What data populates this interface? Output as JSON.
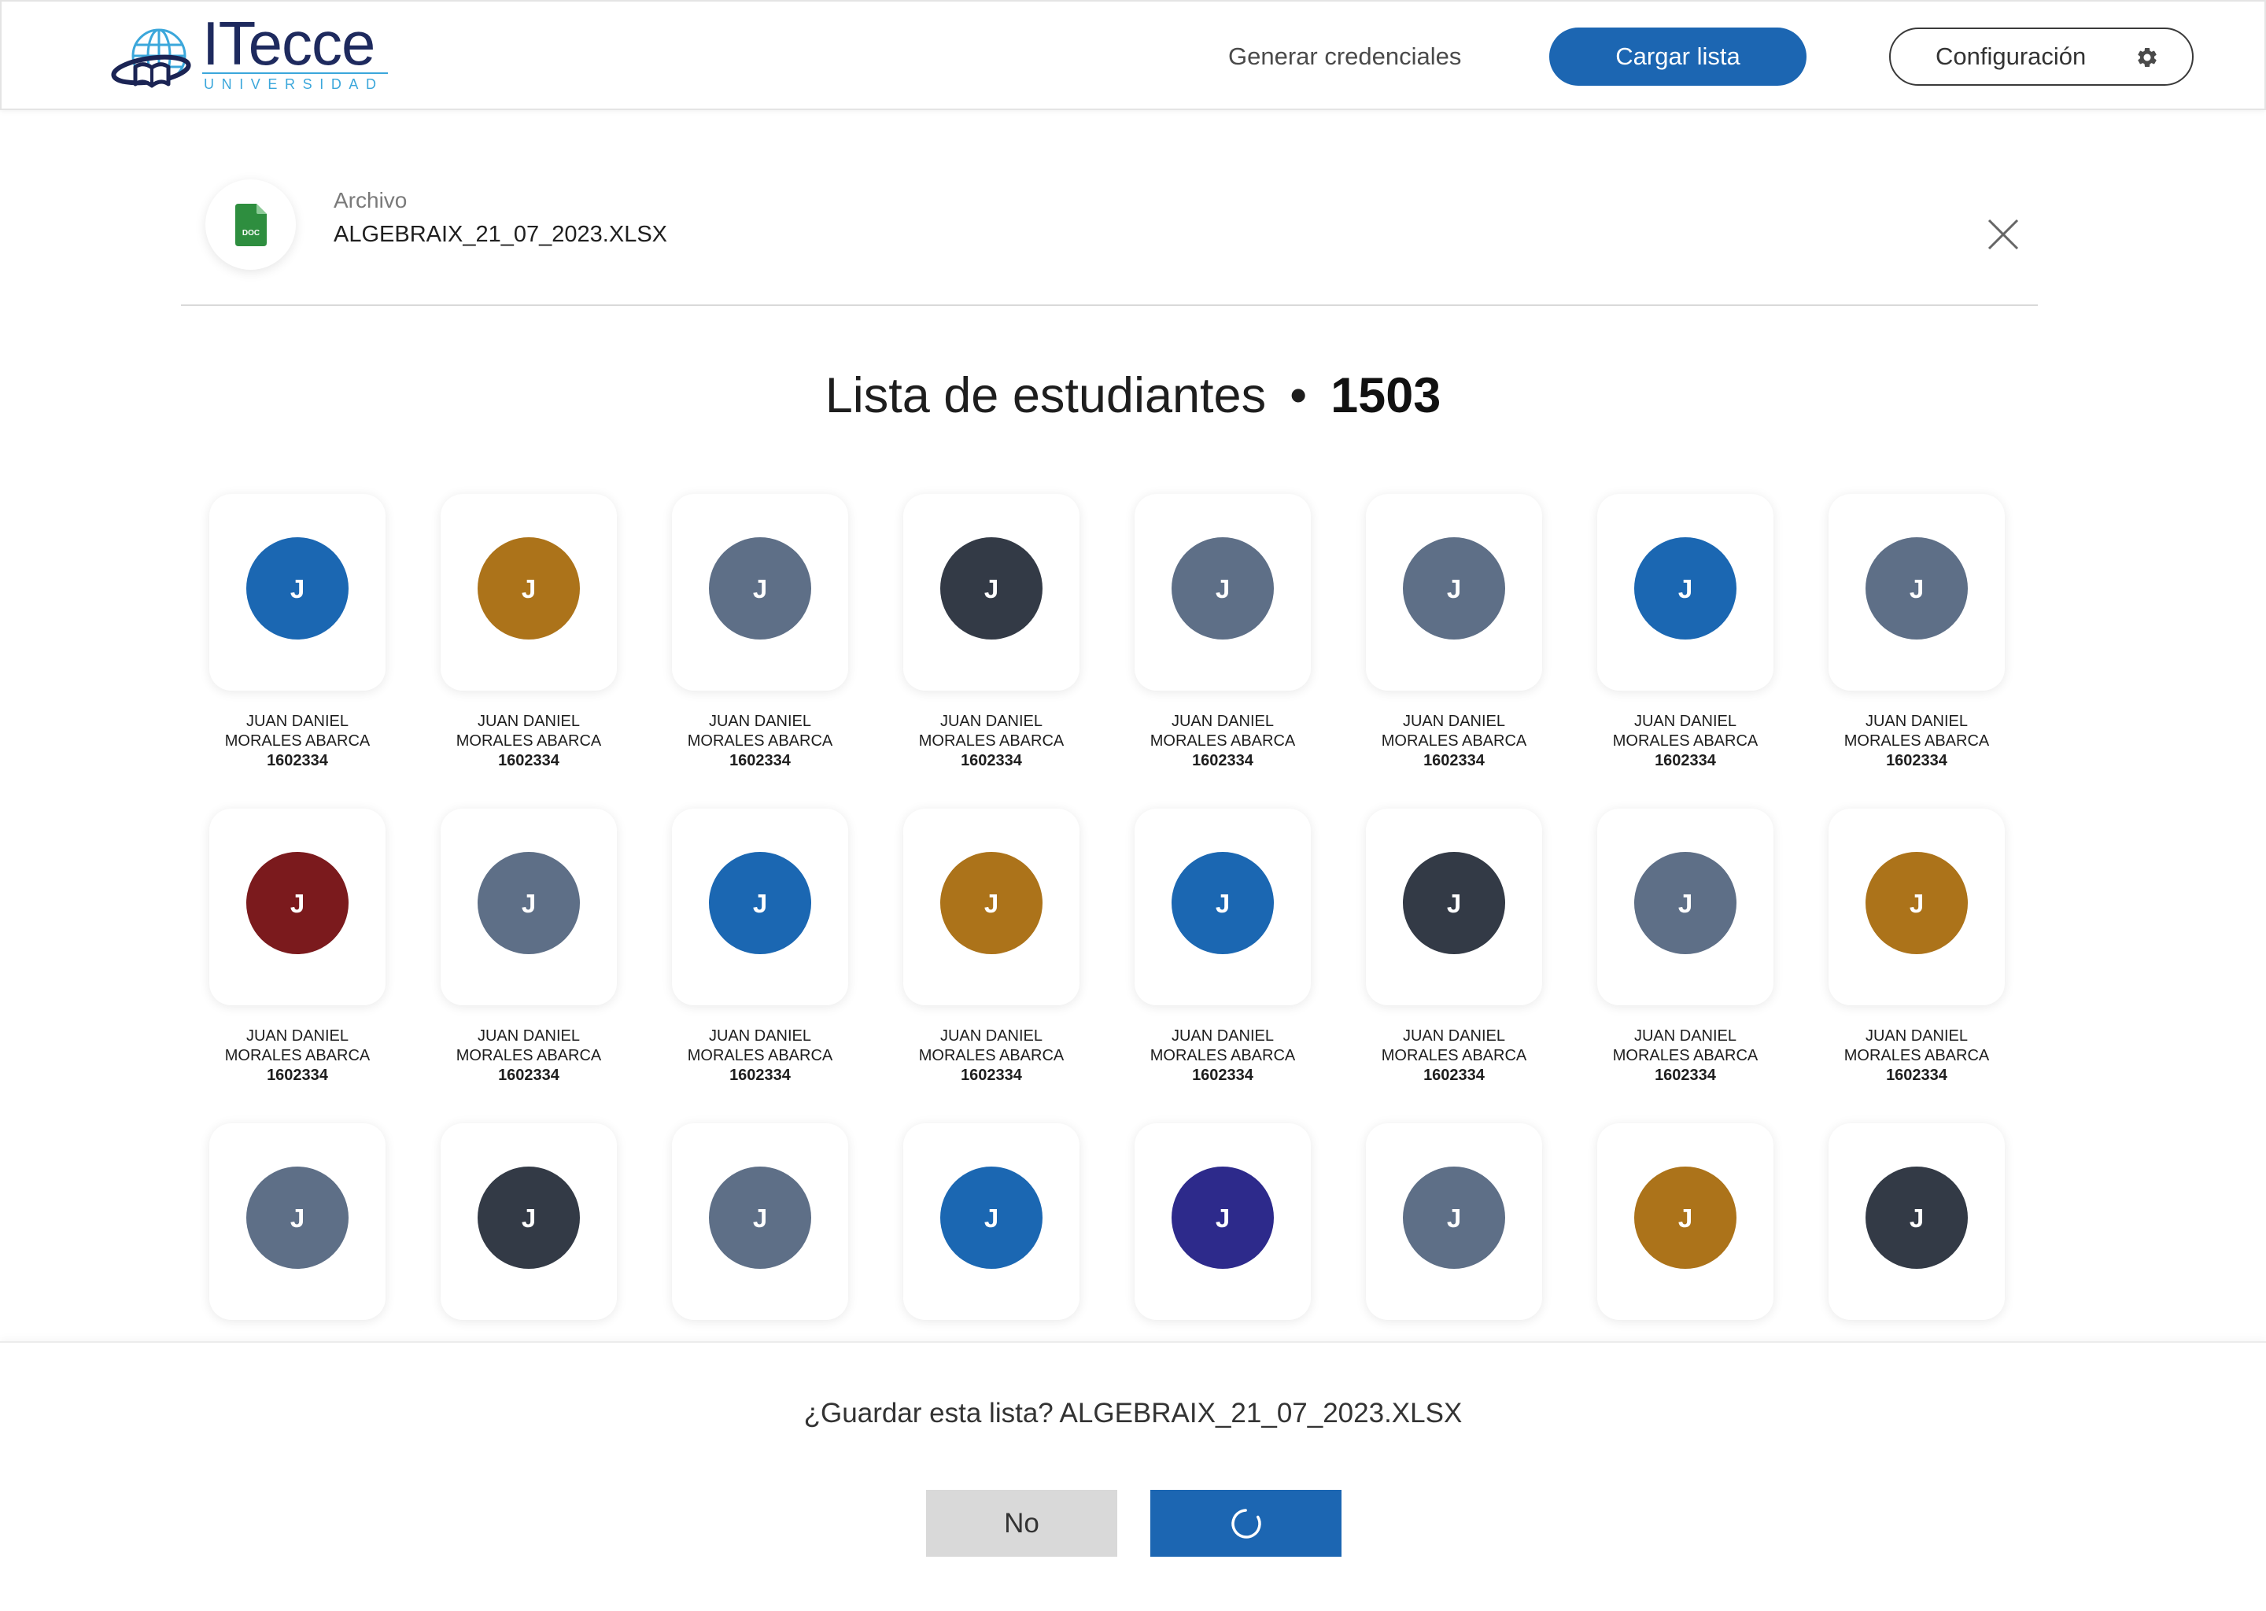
{
  "header": {
    "logo": {
      "wordmark": "ITecce",
      "tagline": "UNIVERSIDAD",
      "icon": "globe-book-logo-icon"
    },
    "nav": {
      "generate_credentials": "Generar credenciales",
      "upload_list": "Cargar lista",
      "settings": "Configuración",
      "settings_icon": "gear-icon"
    }
  },
  "file_panel": {
    "label": "Archivo",
    "filename": "ALGEBRAIX_21_07_2023.XLSX",
    "file_icon": "doc-file-icon",
    "file_type": "DOC",
    "close_icon": "close-icon"
  },
  "student_list": {
    "title": "Lista de estudiantes",
    "separator": "•",
    "count": "1503"
  },
  "students": [
    {
      "initial": "J",
      "color": "#1B67B2",
      "name": "JUAN DANIEL MORALES ABARCA",
      "id": "1602334"
    },
    {
      "initial": "J",
      "color": "#AC731A",
      "name": "JUAN DANIEL MORALES ABARCA",
      "id": "1602334"
    },
    {
      "initial": "J",
      "color": "#5E6F87",
      "name": "JUAN DANIEL MORALES ABARCA",
      "id": "1602334"
    },
    {
      "initial": "J",
      "color": "#333A46",
      "name": "JUAN DANIEL MORALES ABARCA",
      "id": "1602334"
    },
    {
      "initial": "J",
      "color": "#5E6F87",
      "name": "JUAN DANIEL MORALES ABARCA",
      "id": "1602334"
    },
    {
      "initial": "J",
      "color": "#5E6F87",
      "name": "JUAN DANIEL MORALES ABARCA",
      "id": "1602334"
    },
    {
      "initial": "J",
      "color": "#1B67B2",
      "name": "JUAN DANIEL MORALES ABARCA",
      "id": "1602334"
    },
    {
      "initial": "J",
      "color": "#5E6F87",
      "name": "JUAN DANIEL MORALES ABARCA",
      "id": "1602334"
    },
    {
      "initial": "J",
      "color": "#7B1A1D",
      "name": "JUAN DANIEL MORALES ABARCA",
      "id": "1602334"
    },
    {
      "initial": "J",
      "color": "#5E6F87",
      "name": "JUAN DANIEL MORALES ABARCA",
      "id": "1602334"
    },
    {
      "initial": "J",
      "color": "#1B67B2",
      "name": "JUAN DANIEL MORALES ABARCA",
      "id": "1602334"
    },
    {
      "initial": "J",
      "color": "#AC731A",
      "name": "JUAN DANIEL MORALES ABARCA",
      "id": "1602334"
    },
    {
      "initial": "J",
      "color": "#1B67B2",
      "name": "JUAN DANIEL MORALES ABARCA",
      "id": "1602334"
    },
    {
      "initial": "J",
      "color": "#333A46",
      "name": "JUAN DANIEL MORALES ABARCA",
      "id": "1602334"
    },
    {
      "initial": "J",
      "color": "#5E6F87",
      "name": "JUAN DANIEL MORALES ABARCA",
      "id": "1602334"
    },
    {
      "initial": "J",
      "color": "#AC731A",
      "name": "JUAN DANIEL MORALES ABARCA",
      "id": "1602334"
    },
    {
      "initial": "J",
      "color": "#5E6F87"
    },
    {
      "initial": "J",
      "color": "#333A46"
    },
    {
      "initial": "J",
      "color": "#5E6F87"
    },
    {
      "initial": "J",
      "color": "#1B67B2"
    },
    {
      "initial": "J",
      "color": "#2D2A8B"
    },
    {
      "initial": "J",
      "color": "#5E6F87"
    },
    {
      "initial": "J",
      "color": "#AC731A"
    },
    {
      "initial": "J",
      "color": "#333A46"
    }
  ],
  "save_prompt": {
    "question": "¿Guardar esta lista? ALGEBRAIX_21_07_2023.XLSX",
    "no_label": "No",
    "confirm_state": "loading",
    "confirm_icon": "spinner-icon"
  },
  "colors": {
    "primary": "#1C66B2",
    "secondary_button": "#D9D9D9",
    "logo_navy": "#1E2A5E",
    "logo_blue": "#3BA7DB",
    "doc_green": "#2E8E3F"
  }
}
